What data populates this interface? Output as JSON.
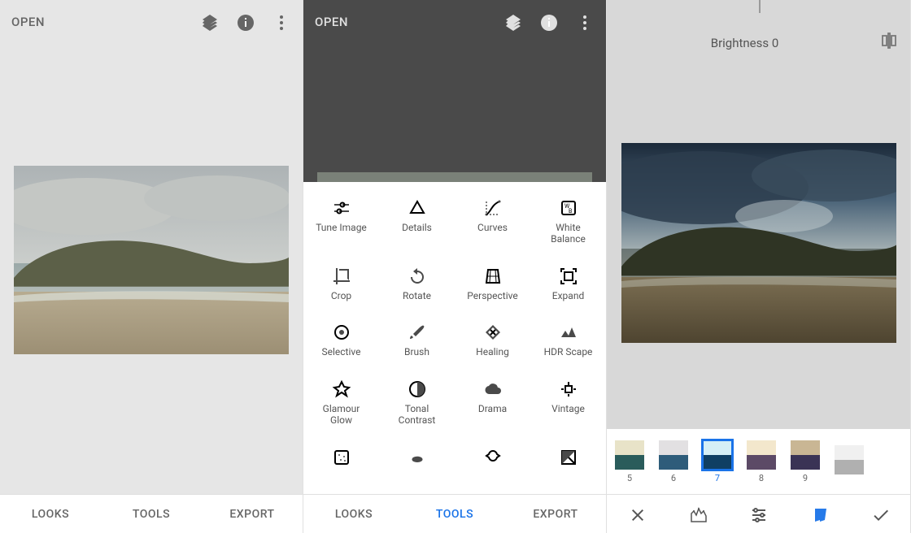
{
  "header": {
    "open_label": "OPEN"
  },
  "tabs": {
    "looks": "LOOKS",
    "tools": "TOOLS",
    "export": "EXPORT"
  },
  "tools": [
    {
      "key": "tune",
      "label": "Tune Image",
      "icon": "tune"
    },
    {
      "key": "details",
      "label": "Details",
      "icon": "details"
    },
    {
      "key": "curves",
      "label": "Curves",
      "icon": "curves"
    },
    {
      "key": "wb",
      "label": "White Balance",
      "icon": "wb"
    },
    {
      "key": "crop",
      "label": "Crop",
      "icon": "crop"
    },
    {
      "key": "rotate",
      "label": "Rotate",
      "icon": "rotate"
    },
    {
      "key": "perspective",
      "label": "Perspective",
      "icon": "perspective"
    },
    {
      "key": "expand",
      "label": "Expand",
      "icon": "expand"
    },
    {
      "key": "selective",
      "label": "Selective",
      "icon": "selective"
    },
    {
      "key": "brush",
      "label": "Brush",
      "icon": "brush"
    },
    {
      "key": "healing",
      "label": "Healing",
      "icon": "healing"
    },
    {
      "key": "hdr",
      "label": "HDR Scape",
      "icon": "hdr"
    },
    {
      "key": "glamour",
      "label": "Glamour Glow",
      "icon": "glamour"
    },
    {
      "key": "tonal",
      "label": "Tonal Contrast",
      "icon": "tonal"
    },
    {
      "key": "drama",
      "label": "Drama",
      "icon": "drama"
    },
    {
      "key": "vintage",
      "label": "Vintage",
      "icon": "vintage"
    },
    {
      "key": "grainy",
      "label": "",
      "icon": "grainy"
    },
    {
      "key": "retro",
      "label": "",
      "icon": "retro"
    },
    {
      "key": "grunge",
      "label": "",
      "icon": "grunge"
    },
    {
      "key": "bw",
      "label": "",
      "icon": "bw"
    }
  ],
  "adjust": {
    "param_label": "Brightness",
    "param_value": "0",
    "display": "Brightness 0"
  },
  "swatches": [
    {
      "n": "5",
      "top": "#e8e3c8",
      "bot": "#2a5c5b",
      "sel": false
    },
    {
      "n": "6",
      "top": "#e2e0e2",
      "bot": "#2e5c7a",
      "sel": false
    },
    {
      "n": "7",
      "top": "#d5eff6",
      "bot": "#0f3f63",
      "sel": true
    },
    {
      "n": "8",
      "top": "#f3e7cc",
      "bot": "#5c4a66",
      "sel": false
    },
    {
      "n": "9",
      "top": "#c9b694",
      "bot": "#3a3355",
      "sel": false
    },
    {
      "n": "",
      "top": "#f0f0f0",
      "bot": "#b0b0b0",
      "sel": false
    }
  ],
  "colors": {
    "accent": "#1a73e8"
  }
}
